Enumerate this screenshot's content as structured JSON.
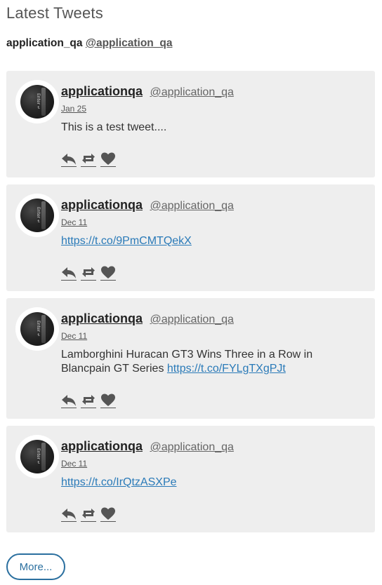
{
  "widget": {
    "title": "Latest Tweets",
    "account_name": "application_qa",
    "account_handle": "@application_qa",
    "more_label": "More..."
  },
  "colors": {
    "card_background": "#eeeeee",
    "link": "#2a7ab8",
    "button_border": "#2a6f9f"
  },
  "icons": [
    "reply-icon",
    "retweet-icon",
    "like-icon"
  ],
  "tweets": [
    {
      "author": "applicationqa",
      "handle": "@application_qa",
      "date": "Jan 25",
      "text": "This is a test tweet....",
      "link": ""
    },
    {
      "author": "applicationqa",
      "handle": "@application_qa",
      "date": "Dec 11",
      "text": "",
      "link": "https://t.co/9PmCMTQekX"
    },
    {
      "author": "applicationqa",
      "handle": "@application_qa",
      "date": "Dec 11",
      "text": "Lamborghini Huracan GT3 Wins Three in a Row in Blancpain GT Series",
      "link": "https://t.co/FYLgTXgPJt"
    },
    {
      "author": "applicationqa",
      "handle": "@application_qa",
      "date": "Dec 11",
      "text": "",
      "link": "https://t.co/IrQtzASXPe"
    }
  ]
}
